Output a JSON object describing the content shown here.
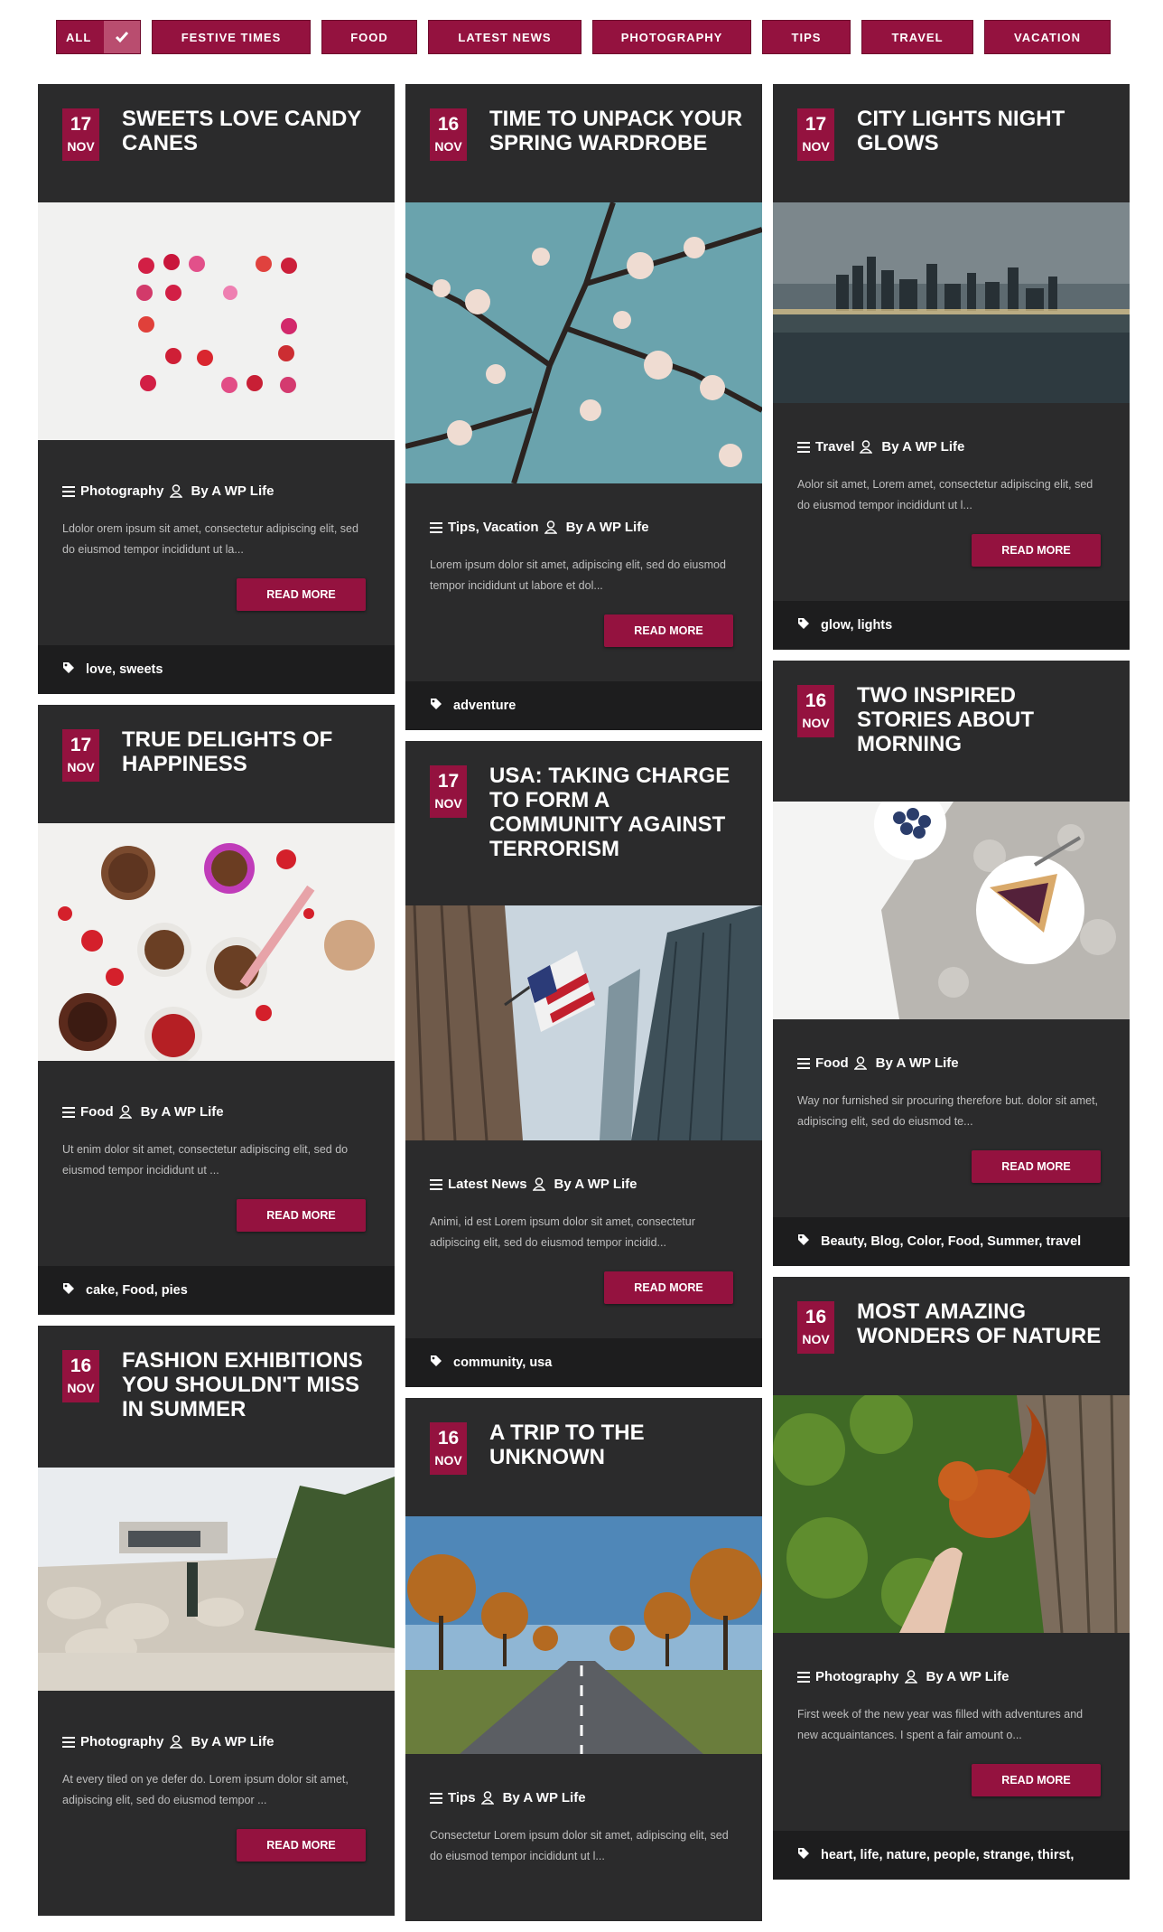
{
  "filters": {
    "items": [
      "All",
      "Festive Times",
      "Food",
      "Latest News",
      "Photography",
      "Tips",
      "Travel",
      "Vacation"
    ]
  },
  "colors": {
    "accent": "#94123f",
    "card_bg": "#2b2b2c",
    "tag_bg": "#1d1d1e"
  },
  "author": "By A WP Life",
  "read_more": "READ MORE",
  "posts": [
    {
      "day": "17",
      "month": "NOV",
      "title": "Sweets Love Candy Canes",
      "category": "Photography",
      "excerpt": "Ldolor orem ipsum sit amet, consectetur adipiscing elit, sed do eiusmod tempor incididunt ut la...",
      "tags": "love, sweets",
      "image": "hearts-photo"
    },
    {
      "day": "16",
      "month": "NOV",
      "title": "Time To Unpack Your Spring Wardrobe",
      "category": "Tips, Vacation",
      "excerpt": "Lorem ipsum dolor sit amet,  adipiscing elit, sed do eiusmod tempor incididunt ut labore et dol...",
      "tags": "adventure",
      "image": "blossom-photo"
    },
    {
      "day": "17",
      "month": "NOV",
      "title": "City Lights Night Glows",
      "category": "Travel",
      "excerpt": "Aolor sit amet, Lorem  amet, consectetur adipiscing elit, sed do eiusmod tempor incididunt ut l...",
      "tags": "glow, lights",
      "image": "city-night-photo"
    },
    {
      "day": "17",
      "month": "NOV",
      "title": "True Delights Of Happiness",
      "category": "Food",
      "excerpt": "Ut enim  dolor sit amet, consectetur adipiscing elit, sed do eiusmod tempor incididunt ut ...",
      "tags": "cake, Food, pies",
      "image": "strawberry-cups-photo"
    },
    {
      "day": "17",
      "month": "NOV",
      "title": "USA: Taking Charge To Form A Community Against Terrorism",
      "category": "Latest News",
      "excerpt": "Animi, id est Lorem ipsum dolor sit amet, consectetur adipiscing elit, sed do eiusmod tempor incidid...",
      "tags": "community, usa",
      "image": "flag-skyscraper-photo"
    },
    {
      "day": "16",
      "month": "NOV",
      "title": "Two Inspired Stories About Morning",
      "category": "Food",
      "excerpt": "Way nor furnished sir procuring therefore but. dolor sit amet,  adipiscing elit, sed do eiusmod te...",
      "tags": "Beauty, Blog, Color, Food, Summer, travel",
      "image": "pie-blueberries-photo"
    },
    {
      "day": "16",
      "month": "NOV",
      "title": "Fashion Exhibitions You Shouldn't Miss In Summer",
      "category": "Photography",
      "excerpt": "At every tiled on ye defer do. Lorem ipsum dolor sit amet,  adipiscing elit, sed do eiusmod tempor ...",
      "tags": "",
      "image": "desert-house-photo"
    },
    {
      "day": "16",
      "month": "NOV",
      "title": "A Trip To The Unknown",
      "category": "Tips",
      "excerpt": "Consectetur Lorem ipsum dolor sit amet,  adipiscing elit, sed do eiusmod tempor incididunt ut l...",
      "tags": "",
      "image": "autumn-road-photo"
    },
    {
      "day": "16",
      "month": "NOV",
      "title": "Most Amazing Wonders Of Nature",
      "category": "Photography",
      "excerpt": "First week of the new year was filled with adventures and new acquaintances. I spent a fair amount o...",
      "tags": "heart, life, nature, people, strange, thirst,",
      "image": "squirrel-photo"
    }
  ]
}
